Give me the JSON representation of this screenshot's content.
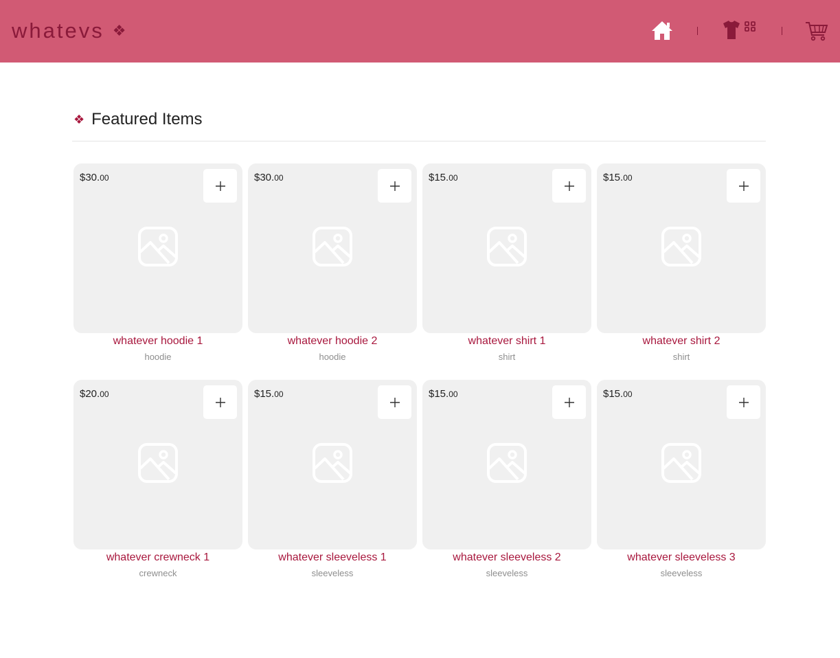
{
  "header": {
    "brand": "whatevs",
    "brand_mark": "❖",
    "accent_color": "#d15a74",
    "brand_color": "#8a1a3a",
    "nav": [
      {
        "icon": "home-icon"
      },
      {
        "icon": "catalog-shirt-grid-icon"
      },
      {
        "icon": "cart-icon"
      }
    ]
  },
  "featured": {
    "mark": "❖",
    "title": "Featured Items",
    "items": [
      {
        "price_main": "$30.",
        "price_cents": "00",
        "name": "whatever hoodie 1",
        "category": "hoodie",
        "add_label": "+"
      },
      {
        "price_main": "$30.",
        "price_cents": "00",
        "name": "whatever hoodie 2",
        "category": "hoodie",
        "add_label": "+"
      },
      {
        "price_main": "$15.",
        "price_cents": "00",
        "name": "whatever shirt 1",
        "category": "shirt",
        "add_label": "+"
      },
      {
        "price_main": "$15.",
        "price_cents": "00",
        "name": "whatever shirt 2",
        "category": "shirt",
        "add_label": "+"
      },
      {
        "price_main": "$20.",
        "price_cents": "00",
        "name": "whatever crewneck 1",
        "category": "crewneck",
        "add_label": "+"
      },
      {
        "price_main": "$15.",
        "price_cents": "00",
        "name": "whatever sleeveless 1",
        "category": "sleeveless",
        "add_label": "+"
      },
      {
        "price_main": "$15.",
        "price_cents": "00",
        "name": "whatever sleeveless 2",
        "category": "sleeveless",
        "add_label": "+"
      },
      {
        "price_main": "$15.",
        "price_cents": "00",
        "name": "whatever sleeveless 3",
        "category": "sleeveless",
        "add_label": "+"
      }
    ]
  }
}
